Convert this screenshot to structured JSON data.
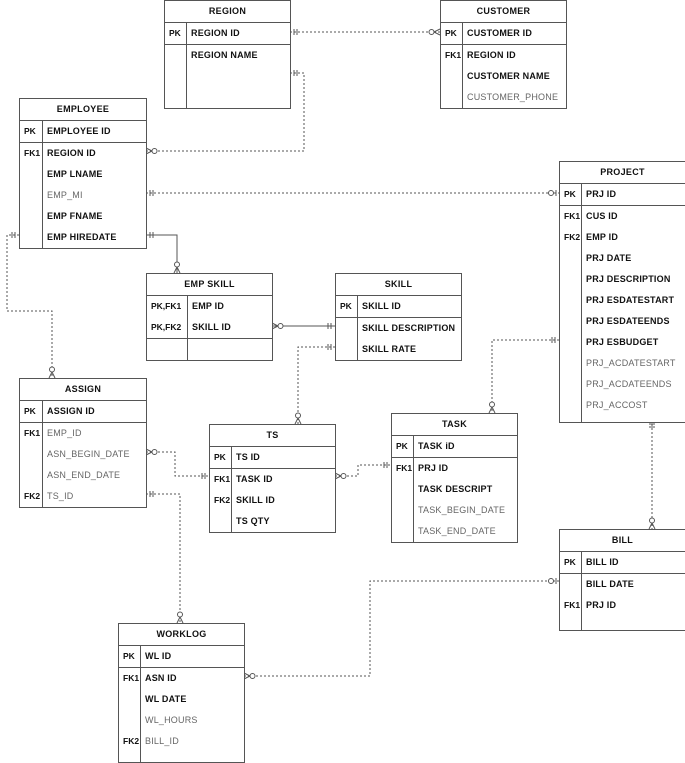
{
  "entities": [
    {
      "id": "region",
      "title": "REGION",
      "pk": [
        {
          "key": "PK",
          "name": "REGION ID",
          "style": "b"
        }
      ],
      "fields": [
        {
          "key": "",
          "name": "REGION NAME",
          "style": "b"
        }
      ]
    },
    {
      "id": "customer",
      "title": "CUSTOMER",
      "pk": [
        {
          "key": "PK",
          "name": "CUSTOMER ID",
          "style": "b"
        }
      ],
      "fields": [
        {
          "key": "FK1",
          "name": "REGION ID",
          "style": "b"
        },
        {
          "key": "",
          "name": "CUSTOMER NAME",
          "style": "b"
        },
        {
          "key": "",
          "name": "CUSTOMER_PHONE",
          "style": "n"
        }
      ]
    },
    {
      "id": "employee",
      "title": "EMPLOYEE",
      "pk": [
        {
          "key": "PK",
          "name": "EMPLOYEE ID",
          "style": "b"
        }
      ],
      "fields": [
        {
          "key": "FK1",
          "name": "REGION ID",
          "style": "b"
        },
        {
          "key": "",
          "name": "EMP LNAME",
          "style": "b"
        },
        {
          "key": "",
          "name": "EMP_MI",
          "style": "n"
        },
        {
          "key": "",
          "name": "EMP FNAME",
          "style": "b"
        },
        {
          "key": "",
          "name": "EMP HIREDATE",
          "style": "b"
        }
      ]
    },
    {
      "id": "project",
      "title": "PROJECT",
      "pk": [
        {
          "key": "PK",
          "name": "PRJ ID",
          "style": "b"
        }
      ],
      "fields": [
        {
          "key": "FK1",
          "name": "CUS ID",
          "style": "b"
        },
        {
          "key": "FK2",
          "name": "EMP ID",
          "style": "b"
        },
        {
          "key": "",
          "name": "PRJ DATE",
          "style": "b"
        },
        {
          "key": "",
          "name": "PRJ DESCRIPTION",
          "style": "b"
        },
        {
          "key": "",
          "name": "PRJ ESDATESTART",
          "style": "b"
        },
        {
          "key": "",
          "name": "PRJ ESDATEENDS",
          "style": "b"
        },
        {
          "key": "",
          "name": "PRJ ESBUDGET",
          "style": "b"
        },
        {
          "key": "",
          "name": "PRJ_ACDATESTART",
          "style": "n"
        },
        {
          "key": "",
          "name": "PRJ_ACDATEENDS",
          "style": "n"
        },
        {
          "key": "",
          "name": "PRJ_ACCOST",
          "style": "n"
        }
      ]
    },
    {
      "id": "empskill",
      "title": "EMP SKILL",
      "pk": [
        {
          "key": "PK,FK1",
          "name": "EMP ID",
          "style": "b"
        },
        {
          "key": "PK,FK2",
          "name": "SKILL ID",
          "style": "b"
        }
      ],
      "fields": []
    },
    {
      "id": "skill",
      "title": "SKILL",
      "pk": [
        {
          "key": "PK",
          "name": "SKILL ID",
          "style": "b"
        }
      ],
      "fields": [
        {
          "key": "",
          "name": "SKILL DESCRIPTION",
          "style": "b"
        },
        {
          "key": "",
          "name": "SKILL RATE",
          "style": "b"
        }
      ]
    },
    {
      "id": "assign",
      "title": "ASSIGN",
      "pk": [
        {
          "key": "PK",
          "name": "ASSIGN ID",
          "style": "b"
        }
      ],
      "fields": [
        {
          "key": "FK1",
          "name": "EMP_ID",
          "style": "n"
        },
        {
          "key": "",
          "name": "ASN_BEGIN_DATE",
          "style": "n"
        },
        {
          "key": "",
          "name": "ASN_END_DATE",
          "style": "n"
        },
        {
          "key": "FK2",
          "name": "TS_ID",
          "style": "n"
        }
      ]
    },
    {
      "id": "ts",
      "title": "TS",
      "pk": [
        {
          "key": "PK",
          "name": "TS ID",
          "style": "b"
        }
      ],
      "fields": [
        {
          "key": "FK1",
          "name": "TASK ID",
          "style": "b"
        },
        {
          "key": "FK2",
          "name": "SKILL ID",
          "style": "b"
        },
        {
          "key": "",
          "name": "TS QTY",
          "style": "b"
        }
      ]
    },
    {
      "id": "task",
      "title": "TASK",
      "pk": [
        {
          "key": "PK",
          "name": "TASK iD",
          "style": "b"
        }
      ],
      "fields": [
        {
          "key": "FK1",
          "name": "PRJ ID",
          "style": "b"
        },
        {
          "key": "",
          "name": "TASK DESCRIPT",
          "style": "b"
        },
        {
          "key": "",
          "name": "TASK_BEGIN_DATE",
          "style": "n"
        },
        {
          "key": "",
          "name": "TASK_END_DATE",
          "style": "n"
        }
      ]
    },
    {
      "id": "bill",
      "title": "BILL",
      "pk": [
        {
          "key": "PK",
          "name": "BILL ID",
          "style": "b"
        }
      ],
      "fields": [
        {
          "key": "",
          "name": "BILL DATE",
          "style": "b"
        },
        {
          "key": "FK1",
          "name": "PRJ ID",
          "style": "b"
        }
      ]
    },
    {
      "id": "worklog",
      "title": "WORKLOG",
      "pk": [
        {
          "key": "PK",
          "name": "WL ID",
          "style": "b"
        }
      ],
      "fields": [
        {
          "key": "FK1",
          "name": "ASN ID",
          "style": "b"
        },
        {
          "key": "",
          "name": "WL DATE",
          "style": "b"
        },
        {
          "key": "",
          "name": "WL_HOURS",
          "style": "n"
        },
        {
          "key": "FK2",
          "name": "BILL_ID",
          "style": "n"
        }
      ]
    }
  ],
  "colors": {
    "border": "#555555",
    "bold_text": "#111111",
    "normal_text": "#666666",
    "connector": "#555555"
  }
}
